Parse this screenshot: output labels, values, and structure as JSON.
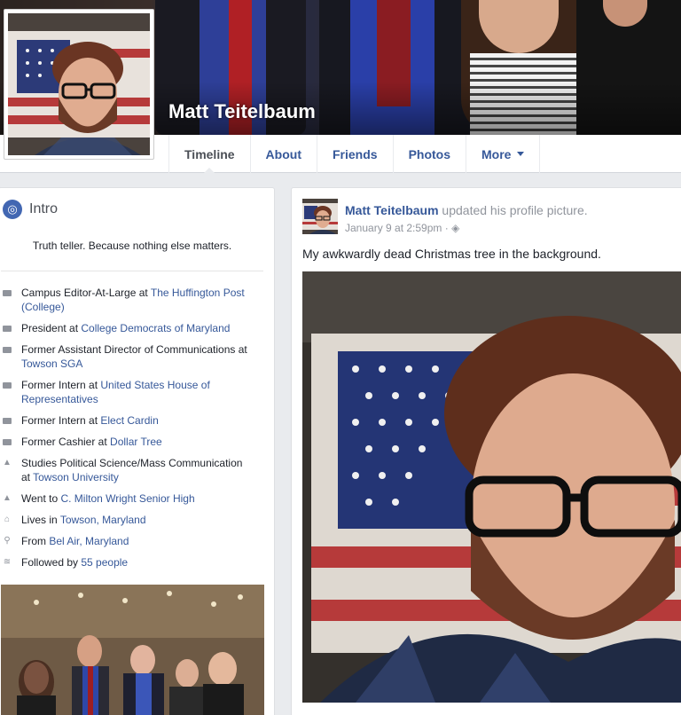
{
  "profile": {
    "name": "Matt Teitelbaum"
  },
  "nav": {
    "tabs": [
      {
        "label": "Timeline"
      },
      {
        "label": "About"
      },
      {
        "label": "Friends"
      },
      {
        "label": "Photos"
      },
      {
        "label": "More"
      }
    ]
  },
  "intro": {
    "title": "Intro",
    "icon": "globe-icon",
    "bio": "Truth teller. Because nothing else matters.",
    "facts": [
      {
        "icon": "briefcase-icon",
        "prefix": "Campus Editor-At-Large at ",
        "link": "The Huffington Post (College)"
      },
      {
        "icon": "briefcase-icon",
        "prefix": "President at ",
        "link": "College Democrats of Maryland"
      },
      {
        "icon": "briefcase-icon",
        "prefix": "Former Assistant Director of Communications at ",
        "link": "Towson SGA"
      },
      {
        "icon": "briefcase-icon",
        "prefix": "Former Intern at ",
        "link": "United States House of Representatives"
      },
      {
        "icon": "briefcase-icon",
        "prefix": "Former Intern at ",
        "link": "Elect Cardin"
      },
      {
        "icon": "briefcase-icon",
        "prefix": "Former Cashier at ",
        "link": "Dollar Tree"
      },
      {
        "icon": "graduation-cap-icon",
        "prefix": "Studies Political Science/Mass Communication at ",
        "link": "Towson University"
      },
      {
        "icon": "graduation-cap-icon",
        "prefix": "Went to ",
        "link": "C. Milton Wright Senior High"
      },
      {
        "icon": "home-icon",
        "prefix": "Lives in ",
        "link": "Towson, Maryland"
      },
      {
        "icon": "location-pin-icon",
        "prefix": "From ",
        "link": "Bel Air, Maryland"
      },
      {
        "icon": "rss-icon",
        "prefix": "Followed by ",
        "link": "55 people"
      }
    ]
  },
  "post": {
    "author": "Matt Teitelbaum",
    "action": " updated his profile picture.",
    "timestamp": "January 9 at 2:59pm",
    "privacy_icon": "globe-icon",
    "text": "My awkwardly dead Christmas tree in the background."
  },
  "colors": {
    "link": "#365899",
    "background": "#e9ebee",
    "muted": "#90949c"
  }
}
